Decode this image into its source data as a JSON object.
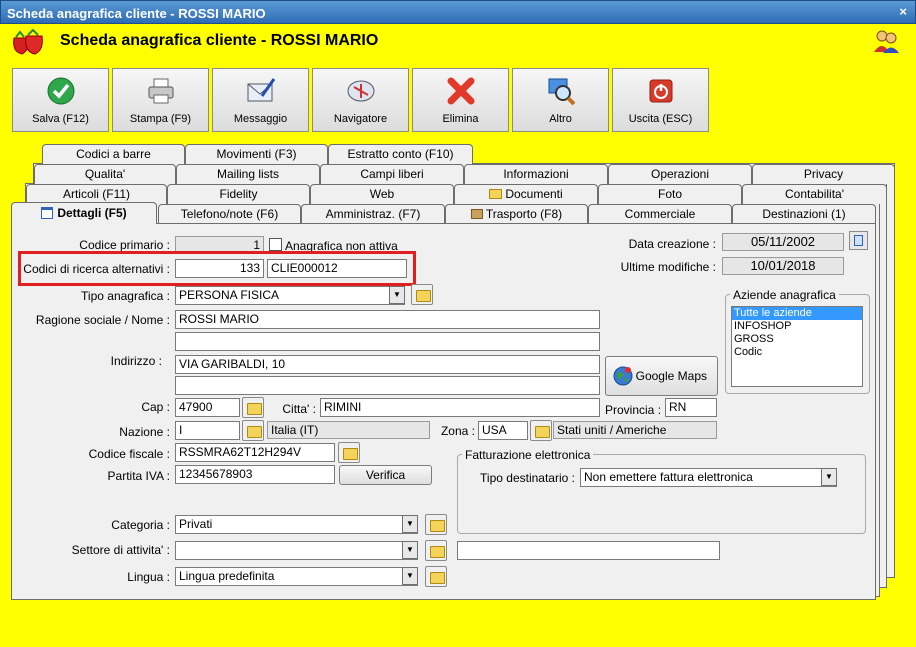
{
  "window": {
    "title": "Scheda anagrafica cliente - ROSSI MARIO",
    "close": "×"
  },
  "header": {
    "title": "Scheda anagrafica cliente - ROSSI MARIO"
  },
  "toolbar": [
    {
      "label": "Salva (F12)",
      "icon": "check-icon"
    },
    {
      "label": "Stampa (F9)",
      "icon": "printer-icon"
    },
    {
      "label": "Messaggio",
      "icon": "message-icon"
    },
    {
      "label": "Navigatore",
      "icon": "compass-icon"
    },
    {
      "label": "Elimina",
      "icon": "delete-icon"
    },
    {
      "label": "Altro",
      "icon": "search-icon"
    },
    {
      "label": "Uscita (ESC)",
      "icon": "exit-icon"
    }
  ],
  "tabs": {
    "row1": [
      "Codici a barre",
      "Movimenti (F3)",
      "Estratto conto (F10)"
    ],
    "row2": [
      "Qualita'",
      "Mailing lists",
      "Campi liberi",
      "Informazioni",
      "Operazioni",
      "Privacy"
    ],
    "row3": [
      "Articoli (F11)",
      "Fidelity",
      "Web",
      "Documenti",
      "Foto",
      "Contabilita'"
    ],
    "row4": [
      "Dettagli (F5)",
      "Telefono/note (F6)",
      "Amministraz. (F7)",
      "Trasporto (F8)",
      "Commerciale",
      "Destinazioni (1)"
    ]
  },
  "form": {
    "codice_primario_label": "Codice primario :",
    "codice_primario_value": "1",
    "anagrafica_non_attiva": "Anagrafica non attiva",
    "codici_ricerca_label": "Codici di ricerca alternativi :",
    "codici_ricerca_num": "133",
    "codici_ricerca_code": "CLIE000012",
    "tipo_label": "Tipo anagrafica :",
    "tipo_value": "PERSONA FISICA",
    "ragione_label": "Ragione sociale / Nome :",
    "ragione_value": "ROSSI MARIO",
    "indirizzo_label": "Indirizzo :",
    "indirizzo_value": "VIA GARIBALDI, 10",
    "google_maps": "Google Maps",
    "cap_label": "Cap :",
    "cap_value": "47900",
    "citta_label": "Citta' :",
    "citta_value": "RIMINI",
    "provincia_label": "Provincia :",
    "provincia_value": "RN",
    "nazione_label": "Nazione :",
    "nazione_value": "I",
    "nazione_desc": "Italia (IT)",
    "zona_label": "Zona :",
    "zona_value": "USA",
    "zona_desc": "Stati uniti / Americhe",
    "cf_label": "Codice fiscale :",
    "cf_value": "RSSMRA62T12H294V",
    "piva_label": "Partita IVA :",
    "piva_value": "12345678903",
    "verifica": "Verifica",
    "categoria_label": "Categoria :",
    "categoria_value": "Privati",
    "settore_label": "Settore di attivita' :",
    "lingua_label": "Lingua :",
    "lingua_value": "Lingua predefinita",
    "data_creazione_label": "Data creazione :",
    "data_creazione_value": "05/11/2002",
    "ultime_mod_label": "Ultime modifiche :",
    "ultime_mod_value": "10/01/2018",
    "aziende_group": "Aziende anagrafica",
    "aziende": [
      "Tutte le aziende",
      "INFOSHOP",
      "GROSS",
      "Codic"
    ],
    "fatturazione_group": "Fatturazione elettronica",
    "tipo_dest_label": "Tipo destinatario :",
    "tipo_dest_value": "Non emettere fattura elettronica"
  },
  "colors": {
    "background": "#ffff00",
    "highlight": "#e02020",
    "selection": "#3399ff"
  }
}
